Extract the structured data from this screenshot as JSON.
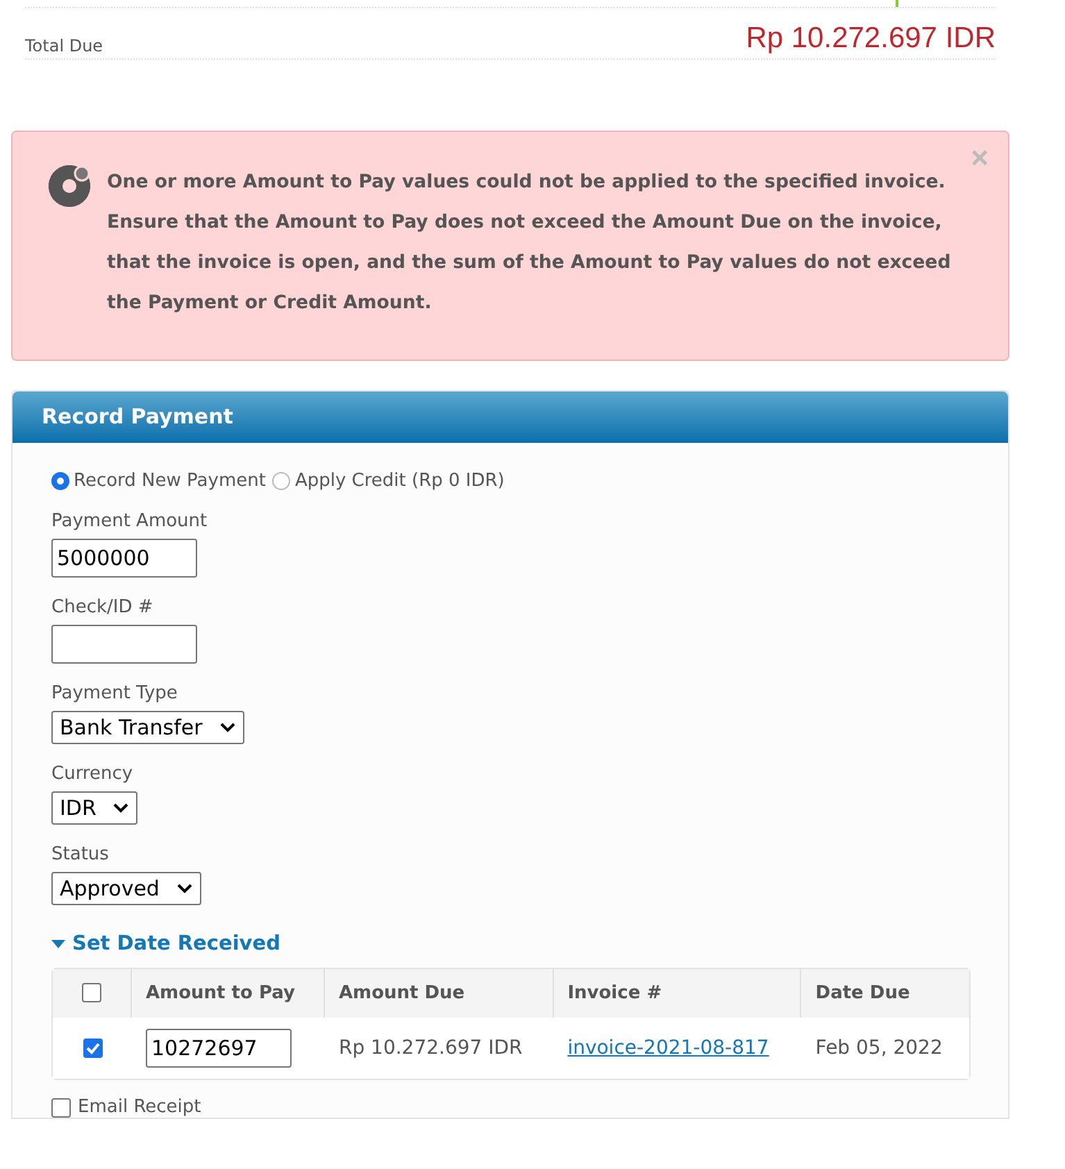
{
  "total": {
    "label": "Total Due",
    "value": "Rp 10.272.697 IDR"
  },
  "alert": {
    "message": "One or more Amount to Pay values could not be applied to the specified invoice. Ensure that the Amount to Pay does not exceed the Amount Due on the invoice, that the invoice is open, and the sum of the Amount to Pay values do not exceed the Payment or Credit Amount.",
    "close": "×"
  },
  "panel": {
    "title": "Record Payment"
  },
  "mode_options": [
    {
      "label": "Record New Payment",
      "selected": true
    },
    {
      "label": "Apply Credit (Rp 0 IDR)",
      "selected": false
    }
  ],
  "fields": [
    {
      "kind": "input",
      "label": "Payment Amount",
      "value": "5000000"
    },
    {
      "kind": "input",
      "label": "Check/ID #"
    },
    {
      "kind": "select",
      "label": "Payment Type",
      "value": "Bank Transfer"
    },
    {
      "kind": "select",
      "label": "Currency",
      "value": "IDR"
    },
    {
      "kind": "select",
      "label": "Status",
      "value": "Approved"
    }
  ],
  "date_toggle": {
    "label": "Set Date Received",
    "expanded": true
  },
  "table": {
    "all_checked": false,
    "columns": [
      "Amount to Pay",
      "Amount Due",
      "Invoice #",
      "Date Due"
    ],
    "rows": [
      {
        "checked": true,
        "amount_to_pay": "10272697",
        "amount_due": "Rp 10.272.697 IDR",
        "invoice": "invoice-2021-08-817",
        "date_due": "Feb 05, 2022"
      }
    ]
  },
  "email_receipt": {
    "label": "Email Receipt",
    "checked": false
  }
}
